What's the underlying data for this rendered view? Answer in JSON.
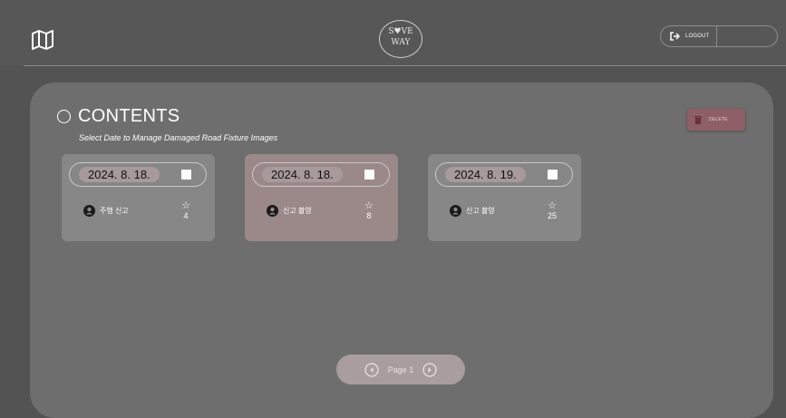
{
  "header": {
    "logo_text_top": "S♥VE",
    "logo_text_bottom": "WAY",
    "logout_label": "LOGOUT"
  },
  "main": {
    "title": "CONTENTS",
    "subtitle": "Select Date to Manage Damaged Road Fixture Images",
    "delete_label": "DELETE",
    "cards": [
      {
        "date": "2024. 8. 18.",
        "label": "주행 신고",
        "count": "4",
        "selected": false
      },
      {
        "date": "2024. 8. 18.",
        "label": "신고 촬영",
        "count": "8",
        "selected": true
      },
      {
        "date": "2024. 8. 19.",
        "label": "신고 촬영",
        "count": "25",
        "selected": false
      }
    ],
    "pagination": {
      "label": "Page 1"
    }
  },
  "colors": {
    "background": "#535353",
    "panel": "#6e6e6e",
    "card": "#878787",
    "card_selected": "#9b8888",
    "delete_button": "#8e5f66",
    "pager": "#a99da0"
  },
  "icons": {
    "header_left": "map-icon",
    "logout": "logout-icon",
    "delete": "trash-icon",
    "title": "circle-icon",
    "card_user": "user-circle-icon",
    "card_rating": "star-icon",
    "prev": "chevron-left-circle-icon",
    "next": "chevron-right-circle-icon"
  }
}
